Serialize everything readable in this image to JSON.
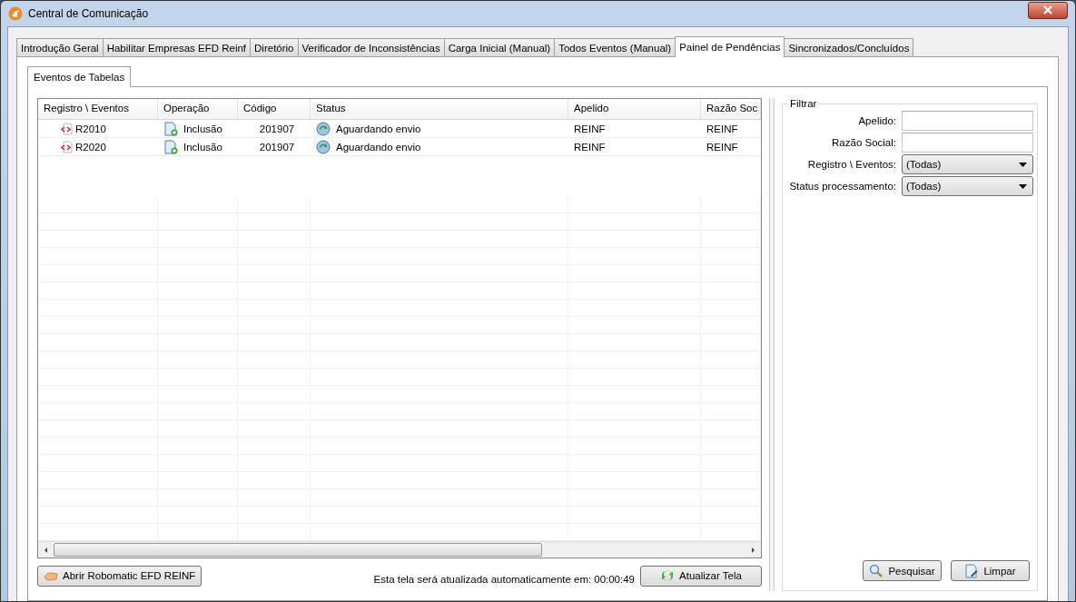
{
  "window": {
    "title": "Central de Comunicação"
  },
  "tabs": [
    {
      "label": "Introdução Geral",
      "selected": false
    },
    {
      "label": "Habilitar Empresas EFD Reinf",
      "selected": false
    },
    {
      "label": "Diretório",
      "selected": false
    },
    {
      "label": "Verificador de Inconsistências",
      "selected": false
    },
    {
      "label": "Carga Inicial (Manual)",
      "selected": false
    },
    {
      "label": "Todos Eventos (Manual)",
      "selected": false
    },
    {
      "label": "Painel de Pendências",
      "selected": true
    },
    {
      "label": "Sincronizados/Concluídos",
      "selected": false
    }
  ],
  "subtabs": [
    {
      "label": "Eventos de Tabelas",
      "selected": true
    }
  ],
  "table": {
    "columns": [
      "Registro \\ Eventos",
      "Operação",
      "Código",
      "Status",
      "Apelido",
      "Razão Soc"
    ],
    "rows": [
      {
        "evento": "R2010",
        "operacao": "Inclusão",
        "codigo": "201907",
        "status": "Aguardando envio",
        "apelido": "REINF",
        "razao": "REINF"
      },
      {
        "evento": "R2020",
        "operacao": "Inclusão",
        "codigo": "201907",
        "status": "Aguardando envio",
        "apelido": "REINF",
        "razao": "REINF"
      }
    ]
  },
  "open_button": "Abrir Robomatic EFD REINF",
  "refresh_note": "Esta tela será atualizada automaticamente em:",
  "countdown": "00:00:49",
  "refresh_button": "Atualizar Tela",
  "filter": {
    "title": "Filtrar",
    "fields": [
      {
        "kind": "text",
        "label": "Apelido:"
      },
      {
        "kind": "text",
        "label": "Razão Social:"
      },
      {
        "kind": "select",
        "label": "Registro \\ Eventos:",
        "value": "(Todas)"
      },
      {
        "kind": "select",
        "label": "Status processamento:",
        "value": "(Todas)"
      }
    ],
    "buttons": [
      {
        "kind": "search",
        "label": "Pesquisar"
      },
      {
        "kind": "clear",
        "label": "Limpar"
      }
    ]
  }
}
